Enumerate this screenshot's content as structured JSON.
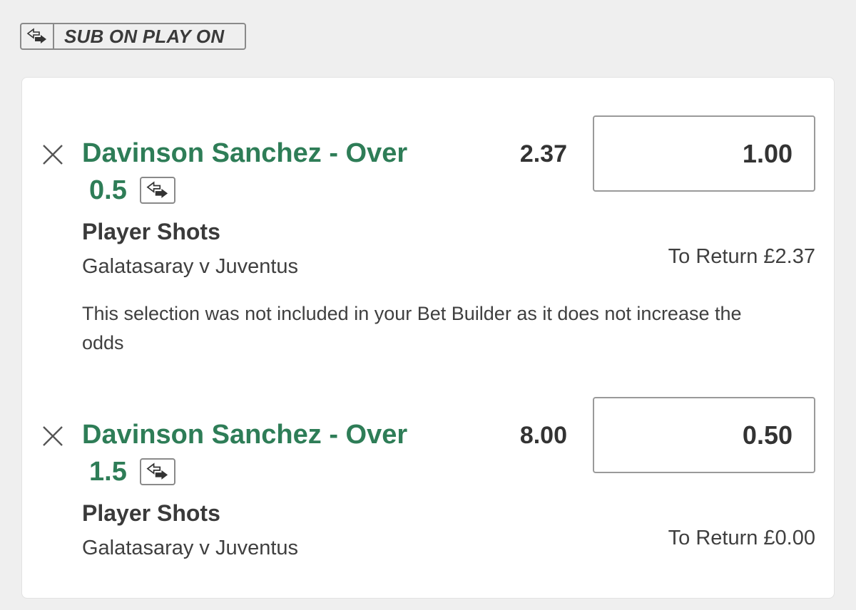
{
  "banner": {
    "label": "SUB ON PLAY ON",
    "icon": "sub-swap-icon"
  },
  "selections": [
    {
      "title_line1": "Davinson Sanchez - Over",
      "title_line2": "0.5",
      "odds": "2.37",
      "stake": "1.00",
      "market": "Player Shots",
      "event": "Galatasaray v Juventus",
      "to_return": "To Return £2.37",
      "note": "This selection was not included in your Bet Builder as it does not increase the odds"
    },
    {
      "title_line1": "Davinson Sanchez - Over",
      "title_line2": "1.5",
      "odds": "8.00",
      "stake": "0.50",
      "market": "Player Shots",
      "event": "Galatasaray v Juventus",
      "to_return": "To Return £0.00"
    }
  ],
  "colors": {
    "accent": "#2e7d57",
    "background": "#efefef",
    "card": "#ffffff"
  }
}
